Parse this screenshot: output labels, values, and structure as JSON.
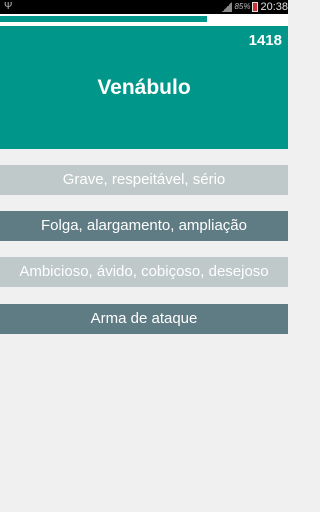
{
  "statusbar": {
    "usb_icon": "usb-icon",
    "battery_percent": "85%",
    "time": "20:38"
  },
  "quiz": {
    "progress": 0.72,
    "counter": "1418",
    "word": "Venábulo",
    "options": [
      "Grave, respeitável, sério",
      "Folga, alargamento, ampliação",
      "Ambicioso, ávido, cobiçoso, desejoso",
      "Arma de ataque"
    ]
  },
  "colors": {
    "accent": "#00968a",
    "option_light": "#bfc9c9",
    "option_dark": "#5f7b84",
    "background": "#f0f0f0"
  }
}
